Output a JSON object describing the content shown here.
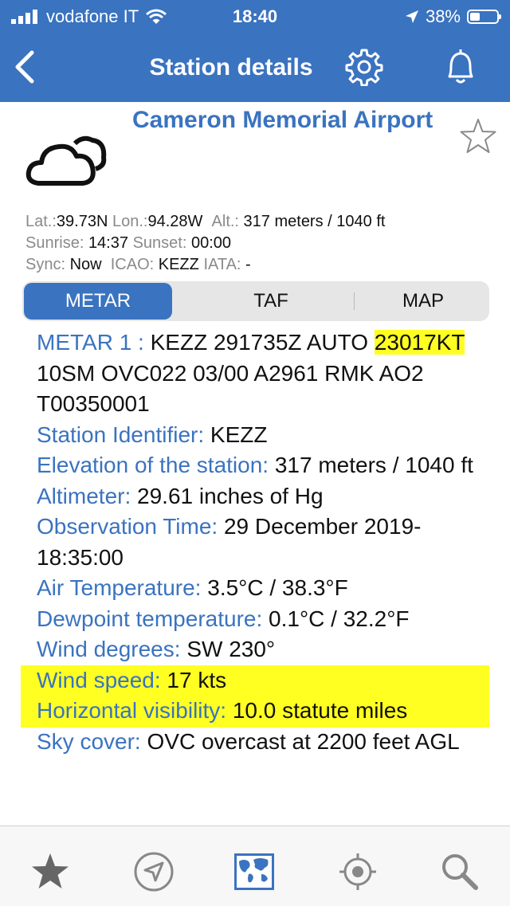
{
  "status_bar": {
    "carrier": "vodafone IT",
    "time": "18:40",
    "battery": "38%"
  },
  "nav": {
    "title": "Station details"
  },
  "station": {
    "name": "Cameron Memorial Airport",
    "lat_label": "Lat.:",
    "lat": "39.73N",
    "lon_label": "Lon.:",
    "lon": "94.28W",
    "alt_label": "Alt.:",
    "alt": "317 meters / 1040 ft",
    "sunrise_label": "Sunrise:",
    "sunrise": "14:37",
    "sunset_label": "Sunset:",
    "sunset": "00:00",
    "sync_label": "Sync:",
    "sync": "Now",
    "icao_label": "ICAO:",
    "icao": "KEZZ",
    "iata_label": "IATA:",
    "iata": "-"
  },
  "tabs": {
    "metar": "METAR",
    "taf": "TAF",
    "map": "MAP",
    "active": "METAR"
  },
  "metar": {
    "label": "METAR 1 :",
    "raw_part1": "KEZZ 291735Z AUTO",
    "raw_wind": "23017KT",
    "raw_part2": "10SM OVC022 03/00 A2961 RMK AO2 T00350001",
    "rows": [
      {
        "label": "Station Identifier:",
        "value": "KEZZ"
      },
      {
        "label": "Elevation of the station:",
        "value": "317 meters / 1040 ft"
      },
      {
        "label": "Altimeter:",
        "value": "29.61 inches of Hg"
      },
      {
        "label": "Observation Time:",
        "value": "29 December 2019-18:35:00"
      },
      {
        "label": "Air Temperature:",
        "value": "3.5°C / 38.3°F"
      },
      {
        "label": "Dewpoint temperature:",
        "value": "0.1°C / 32.2°F"
      },
      {
        "label": "Wind degrees:",
        "value": "SW 230°"
      },
      {
        "label": "Wind speed:",
        "value": "17 kts"
      },
      {
        "label": "Horizontal visibility:",
        "value": "10.0 statute miles"
      },
      {
        "label": "Sky cover:",
        "value": "OVC overcast at 2200 feet AGL"
      }
    ]
  },
  "tab_bar": {
    "icons": [
      "star-icon",
      "navigation-arrow-icon",
      "world-map-icon",
      "gps-target-icon",
      "search-icon"
    ]
  },
  "colors": {
    "brand_blue": "#3a73c0",
    "highlight_yellow": "#ffff22"
  }
}
